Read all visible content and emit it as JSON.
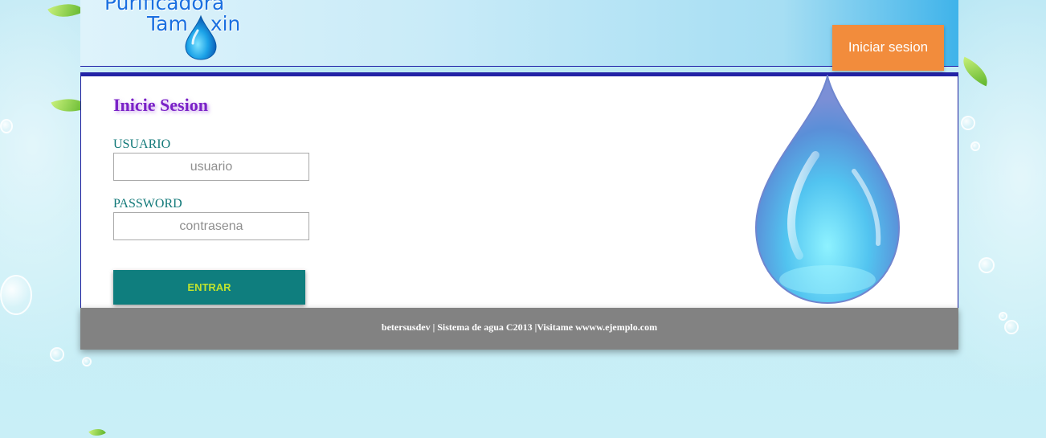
{
  "header": {
    "logo_line1": "Purificadora",
    "logo_line2_a": "Tam",
    "logo_line2_b": "xin",
    "login_button_label": "Iniciar sesion"
  },
  "form": {
    "title": "Inicie Sesion",
    "username_label": "USUARIO",
    "username_placeholder": "usuario",
    "password_label": "PASSWORD",
    "password_placeholder": "contrasena",
    "submit_label": "ENTRAR"
  },
  "footer": {
    "text": "betersusdev | Sistema de agua C2013 |Visitame wwww.ejemplo.com"
  },
  "icons": {
    "logo_drop": "water-drop-icon",
    "hero_drop": "water-drop-icon"
  },
  "colors": {
    "accent_orange": "#f28c3c",
    "button_teal": "#0f7e7e",
    "title_purple": "#7a22c7",
    "footer_gray": "#828282",
    "panel_border": "#2323a6"
  }
}
